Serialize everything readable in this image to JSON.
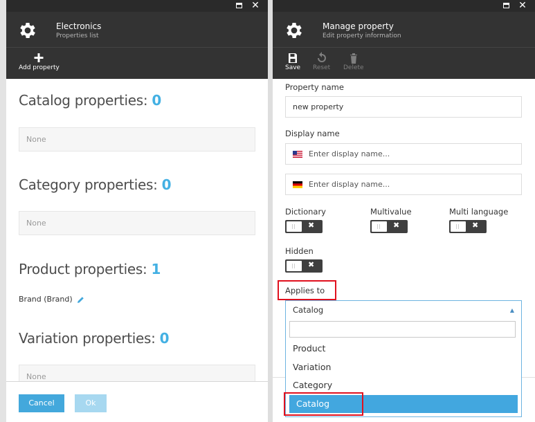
{
  "left_blade": {
    "title": "Electronics",
    "subtitle": "Properties list",
    "toolbar": {
      "add_label": "Add property"
    },
    "sections": [
      {
        "label": "Catalog properties: ",
        "count": "0",
        "empty_text": "None"
      },
      {
        "label": "Category properties: ",
        "count": "0",
        "empty_text": "None"
      },
      {
        "label": "Product properties: ",
        "count": "1",
        "items": [
          "Brand (Brand)"
        ]
      },
      {
        "label": "Variation properties: ",
        "count": "0",
        "empty_text": "None"
      }
    ],
    "footer": {
      "cancel_label": "Cancel",
      "ok_label": "Ok"
    }
  },
  "right_blade": {
    "title": "Manage property",
    "subtitle": "Edit property information",
    "toolbar": {
      "save_label": "Save",
      "reset_label": "Reset",
      "delete_label": "Delete"
    },
    "form": {
      "property_name_label": "Property name",
      "property_name_value": "new property",
      "display_name_label": "Display name",
      "display_name_placeholder_en": "Enter display name...",
      "display_name_placeholder_de": "Enter display name...",
      "dictionary_label": "Dictionary",
      "multivalue_label": "Multivalue",
      "multilanguage_label": "Multi language",
      "hidden_label": "Hidden",
      "applies_to_label": "Applies to",
      "applies_to_value": "Catalog",
      "applies_to_options": [
        "Product",
        "Variation",
        "Category",
        "Catalog"
      ]
    }
  },
  "colors": {
    "accent": "#43b0e3",
    "header_bg": "#333333",
    "highlight": "#e0101e",
    "selected_option": "#42a7df"
  },
  "icons": [
    "gear-icon",
    "plus-icon",
    "save-icon",
    "reset-icon",
    "delete-icon",
    "pencil-icon",
    "us-flag-icon",
    "de-flag-icon",
    "maximize-icon",
    "close-icon",
    "caret-up-icon"
  ]
}
